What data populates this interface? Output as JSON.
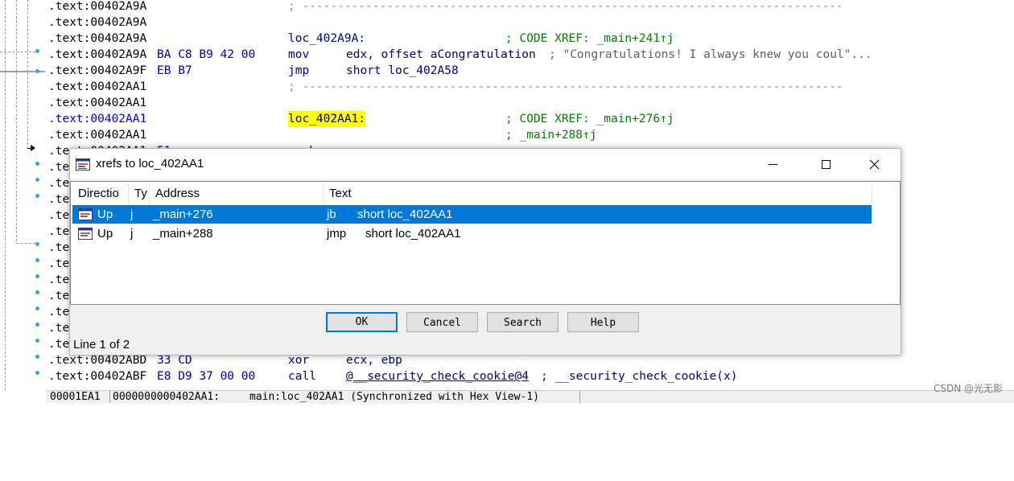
{
  "listing": {
    "lines": [
      {
        "seg": ".text:00402A9A",
        "bytes": "",
        "label": "",
        "mnem": "",
        "operand": "",
        "comment": "",
        "dashes": "; -----------------------------------------------------------------------------"
      },
      {
        "seg": ".text:00402A9A",
        "bytes": "",
        "label": "",
        "mnem": "",
        "operand": "",
        "comment": "",
        "dashes": ""
      },
      {
        "seg": ".text:00402A9A",
        "bytes": "",
        "label": "loc_402A9A:",
        "mnem": "",
        "operand": "",
        "comment": "; CODE XREF: _main+241↑j",
        "dashes": ""
      },
      {
        "seg": ".text:00402A9A",
        "bytes": "BA C8 B9 42 00",
        "label": "",
        "mnem": "mov",
        "operand": "edx, offset aCongratulation",
        "comment": "; \"Congratulations! I always knew you coul\"...",
        "dashes": ""
      },
      {
        "seg": ".text:00402A9F",
        "bytes": "EB B7",
        "label": "",
        "mnem": "jmp",
        "operand": "short loc_402A58",
        "comment": "",
        "dashes": ""
      },
      {
        "seg": ".text:00402AA1",
        "bytes": "",
        "label": "",
        "mnem": "",
        "operand": "",
        "comment": "",
        "dashes": "; -----------------------------------------------------------------------------"
      },
      {
        "seg": ".text:00402AA1",
        "bytes": "",
        "label": "",
        "mnem": "",
        "operand": "",
        "comment": "",
        "dashes": ""
      },
      {
        "seg": ".text:00402AA1",
        "bytes": "",
        "label": "loc_402AA1:",
        "mnem": "",
        "operand": "",
        "comment": "; CODE XREF: _main+276↑j",
        "dashes": ""
      },
      {
        "seg": ".text:00402AA1",
        "bytes": "",
        "label": "",
        "mnem": "",
        "operand": "",
        "comment": "; _main+288↑j",
        "dashes": ""
      },
      {
        "seg": ".text:00402AA1",
        "bytes": "51",
        "label": "",
        "mnem": "push",
        "operand": "",
        "comment": "",
        "dashes": ""
      },
      {
        "seg": ".te",
        "bytes": "",
        "label": "",
        "mnem": "",
        "operand": "",
        "comment": "",
        "dashes": ""
      },
      {
        "seg": ".te",
        "bytes": "",
        "label": "",
        "mnem": "",
        "operand": "",
        "comment": "",
        "dashes": ""
      },
      {
        "seg": ".te",
        "bytes": "",
        "label": "",
        "mnem": "",
        "operand": "",
        "comment": "",
        "dashes": ""
      },
      {
        "seg": ".te",
        "bytes": "",
        "label": "",
        "mnem": "",
        "operand": "",
        "comment": "",
        "dashes": ""
      },
      {
        "seg": ".te",
        "bytes": "",
        "label": "",
        "mnem": "",
        "operand": "",
        "comment": "",
        "dashes": ""
      },
      {
        "seg": ".te",
        "bytes": "",
        "label": "",
        "mnem": "",
        "operand": "",
        "comment": "",
        "dashes": ""
      },
      {
        "seg": ".te",
        "bytes": "",
        "label": "",
        "mnem": "",
        "operand": "",
        "comment": "",
        "dashes": ""
      },
      {
        "seg": ".te",
        "bytes": "",
        "label": "",
        "mnem": "",
        "operand": "",
        "comment": "",
        "dashes": ""
      },
      {
        "seg": ".te",
        "bytes": "",
        "label": "",
        "mnem": "",
        "operand": "",
        "comment": "",
        "dashes": ""
      },
      {
        "seg": ".te",
        "bytes": "",
        "label": "",
        "mnem": "",
        "operand": "",
        "comment": "",
        "dashes": ""
      },
      {
        "seg": ".te",
        "bytes": "",
        "label": "",
        "mnem": "",
        "operand": "",
        "comment": "",
        "dashes": ""
      },
      {
        "seg": ".te",
        "bytes": "",
        "label": "",
        "mnem": "",
        "operand": "",
        "comment": "",
        "dashes": ""
      },
      {
        "seg": ".text:00402ABD",
        "bytes": "33 CD",
        "label": "",
        "mnem": "xor",
        "operand": "ecx, ebp",
        "comment": "",
        "dashes": ""
      },
      {
        "seg": ".text:00402ABF",
        "bytes": "E8 D9 37 00 00",
        "label": "",
        "mnem": "call",
        "operand": "@__security_check_cookie@4",
        "comment": "; __security_check_cookie(x)",
        "dashes": ""
      }
    ]
  },
  "statusbar": {
    "offset": "00001EA1",
    "location": "0000000000402AA1:",
    "context": "main:loc_402AA1 (Synchronized with Hex View-1)"
  },
  "watermark": "CSDN @光无影",
  "dialog": {
    "title": "xrefs to loc_402AA1",
    "columns": [
      "Directio",
      "Ty",
      "Address",
      "Text"
    ],
    "rows": [
      {
        "direction": "Up",
        "type": "j",
        "address": "_main+276",
        "mnem": "jb",
        "operand": "short loc_402AA1",
        "selected": true
      },
      {
        "direction": "Up",
        "type": "j",
        "address": "_main+288",
        "mnem": "jmp",
        "operand": "short loc_402AA1",
        "selected": false
      }
    ],
    "buttons": {
      "ok": "OK",
      "cancel": "Cancel",
      "search": "Search",
      "help": "Help"
    },
    "line_info": "Line 1 of 2",
    "colors": {
      "selection": "#0078d7",
      "ok_focus": "#0078d7"
    }
  },
  "colors": {
    "highlight": "#ffff00",
    "comment": "#008000",
    "code": "#000080"
  }
}
